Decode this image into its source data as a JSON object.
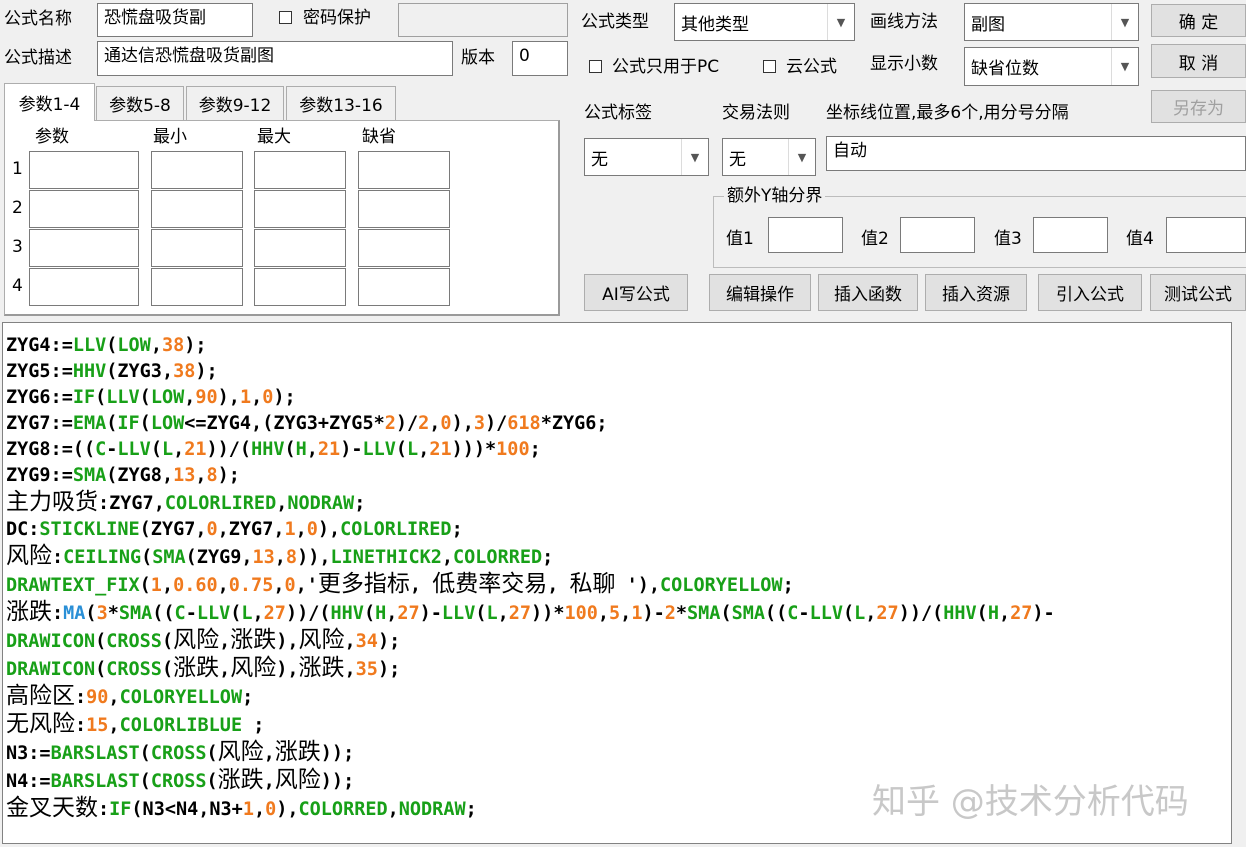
{
  "header": {
    "name_label": "公式名称",
    "name_value": "恐慌盘吸货副",
    "password_label": "密码保护",
    "desc_label": "公式描述",
    "desc_value": "通达信恐慌盘吸货副图",
    "version_label": "版本",
    "version_value": "0"
  },
  "right": {
    "type_label": "公式类型",
    "type_value": "其他类型",
    "draw_label": "画线方法",
    "draw_value": "副图",
    "pc_only_label": "公式只用于PC",
    "cloud_label": "云公式",
    "decimals_label": "显示小数",
    "decimals_value": "缺省位数",
    "tag_label": "公式标签",
    "tag_value": "无",
    "rule_label": "交易法则",
    "rule_value": "无",
    "coord_label": "坐标线位置,最多6个,用分号分隔",
    "coord_value": "自动",
    "yaxis_group": "额外Y轴分界",
    "y_values": [
      "值1",
      "值2",
      "值3",
      "值4"
    ]
  },
  "buttons": {
    "ok": "确  定",
    "cancel": "取  消",
    "save_as": "另存为",
    "ai": "AI写公式",
    "edit": "编辑操作",
    "insert_func": "插入函数",
    "insert_res": "插入资源",
    "import": "引入公式",
    "test": "测试公式"
  },
  "params": {
    "tabs": [
      "参数1-4",
      "参数5-8",
      "参数9-12",
      "参数13-16"
    ],
    "columns": [
      "参数",
      "最小",
      "最大",
      "缺省"
    ],
    "rows": [
      "1",
      "2",
      "3",
      "4"
    ]
  },
  "code_lines": [
    "ZYG4:=LLV(LOW,38);",
    "ZYG5:=HHV(ZYG3,38);",
    "ZYG6:=IF(LLV(LOW,90),1,0);",
    "ZYG7:=EMA(IF(LOW<=ZYG4,(ZYG3+ZYG5*2)/2,0),3)/618*ZYG6;",
    "ZYG8:=((C-LLV(L,21))/(HHV(H,21)-LLV(L,21)))*100;",
    "ZYG9:=SMA(ZYG8,13,8);",
    "主力吸货:ZYG7,COLORLIRED,NODRAW;",
    "DC:STICKLINE(ZYG7,0,ZYG7,1,0),COLORLIRED;",
    "风险:CEILING(SMA(ZYG9,13,8)),LINETHICK2,COLORRED;",
    "DRAWTEXT_FIX(1,0.60,0.75,0,'更多指标, 低费率交易, 私聊 '),COLORYELLOW;",
    "涨跌:MA(3*SMA((C-LLV(L,27))/(HHV(H,27)-LLV(L,27))*100,5,1)-2*SMA(SMA((C-LLV(L,27))/(HHV(H,27)-",
    "DRAWICON(CROSS(风险,涨跌),风险,34);",
    "DRAWICON(CROSS(涨跌,风险),涨跌,35);",
    "高险区:90,COLORYELLOW;",
    "无风险:15,COLORLIBLUE ;",
    "N3:=BARSLAST(CROSS(风险,涨跌));",
    "N4:=BARSLAST(CROSS(涨跌,风险));",
    "金叉天数:IF(N3<N4,N3+1,0),COLORRED,NODRAW;"
  ],
  "watermark": "知乎 @技术分析代码",
  "colors": {
    "keyword": "#18a018",
    "number": "#f07a1e",
    "function_ma": "#2a8fd6",
    "background": "#f0f0f0"
  }
}
